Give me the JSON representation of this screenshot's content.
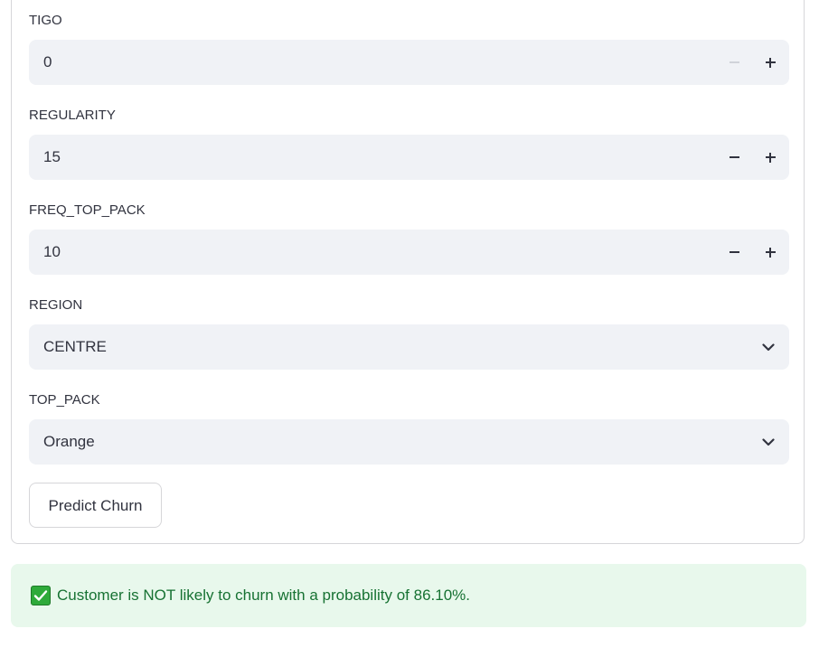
{
  "form": {
    "tigo": {
      "label": "TIGO",
      "value": "0",
      "minus_disabled": true
    },
    "regularity": {
      "label": "REGULARITY",
      "value": "15"
    },
    "freq_top_pack": {
      "label": "FREQ_TOP_PACK",
      "value": "10"
    },
    "region": {
      "label": "REGION",
      "selected": "CENTRE"
    },
    "top_pack": {
      "label": "TOP_PACK",
      "selected": "Orange"
    },
    "predict_button": "Predict Churn"
  },
  "result": {
    "message": "Customer is NOT likely to churn with a probability of 86.10%.",
    "icon": "check-box-icon",
    "color": "#177233",
    "background": "#e8f8ec"
  }
}
